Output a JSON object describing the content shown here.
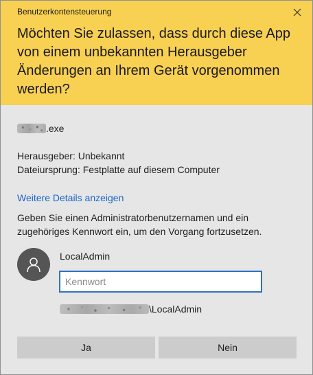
{
  "dialog": {
    "title": "Benutzerkontensteuerung",
    "question": "Möchten Sie zulassen, dass durch diese App von einem unbekannten Herausgeber Änderungen an Ihrem Gerät vorgenommen werden?",
    "close_icon": "close-icon"
  },
  "app": {
    "name_suffix": ".exe"
  },
  "info": {
    "publisher": "Herausgeber: Unbekannt",
    "origin": "Dateiursprung: Festplatte auf diesem Computer"
  },
  "details_link": "Weitere Details anzeigen",
  "instructions": "Geben Sie einen Administratorbenutzernamen und ein zugehöriges Kennwort ein, um den Vorgang fortzusetzen.",
  "credentials": {
    "user_name": "LocalAdmin",
    "password_placeholder": "Kennwort",
    "password_value": "",
    "domain_suffix": "\\LocalAdmin",
    "avatar_icon": "user-icon"
  },
  "buttons": {
    "yes": "Ja",
    "no": "Nein"
  },
  "colors": {
    "header": "#f8d052",
    "body": "#e6e6e6",
    "link": "#1a67c5",
    "input_border": "#2e71c4",
    "button": "#cccccc",
    "avatar": "#555555"
  }
}
